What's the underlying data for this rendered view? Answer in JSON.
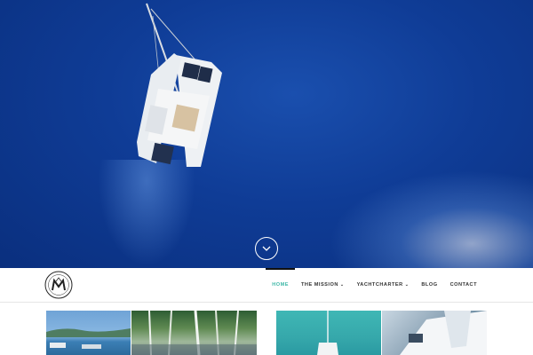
{
  "colors": {
    "accent": "#3fb8a8",
    "ocean": "#0f3c96",
    "nav_text": "#333333"
  },
  "hero": {
    "scroll_icon": "chevron-down-icon"
  },
  "brand": {
    "logo_icon": "logo-m-seal-icon"
  },
  "nav": {
    "items": [
      {
        "label": "HOME",
        "active": true
      },
      {
        "label": "THE MISSION",
        "dropdown": true
      },
      {
        "label": "YACHTCHARTER",
        "dropdown": true
      },
      {
        "label": "BLOG"
      },
      {
        "label": "CONTACT"
      }
    ],
    "dropdown_icon": "chevron-down-icon"
  },
  "gallery": {
    "tiles": [
      "coast-photo",
      "marina-masts-photo",
      "catamaran-turquoise-photo",
      "yacht-deck-photo"
    ]
  }
}
